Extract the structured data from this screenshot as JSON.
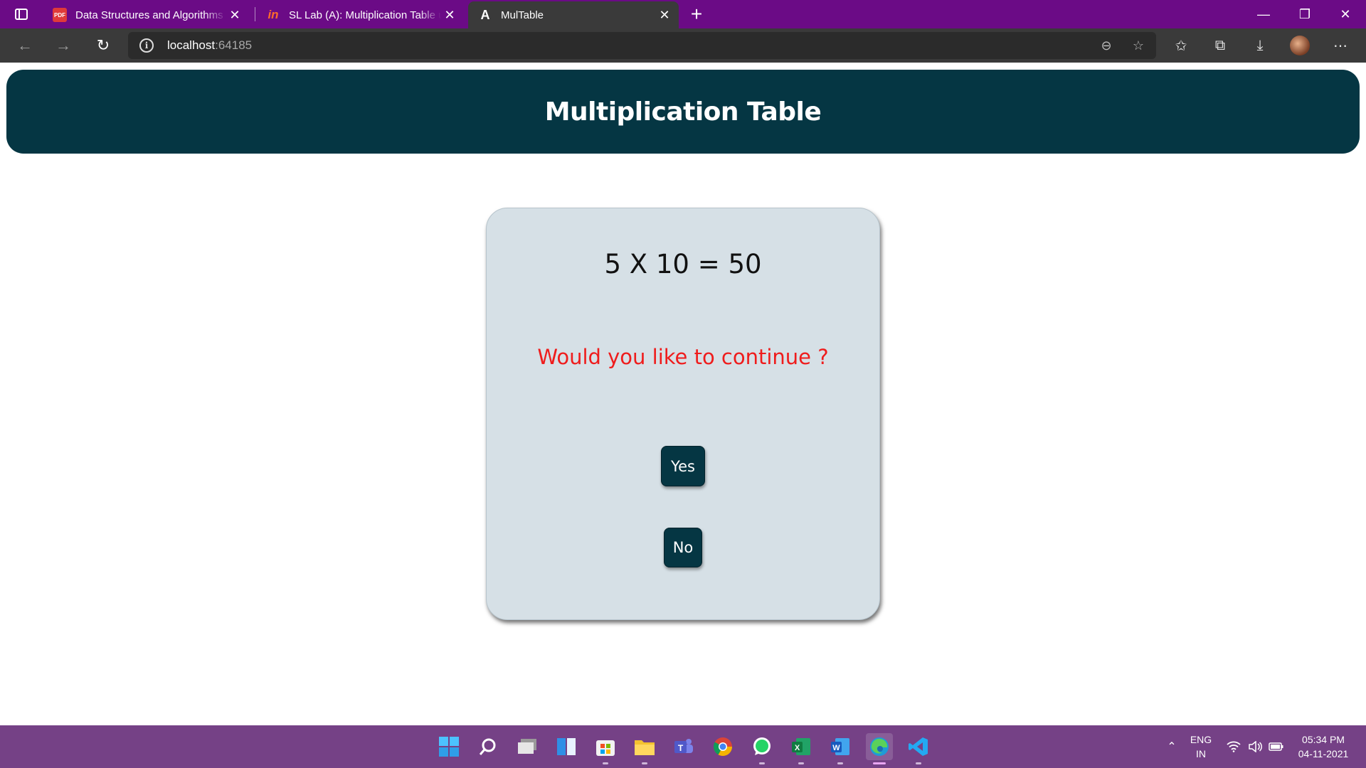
{
  "browser": {
    "tabs": [
      {
        "title": "Data Structures and Algorithms",
        "icon": "pdf-icon",
        "active": false
      },
      {
        "title": "SL Lab (A): Multiplication Table u",
        "icon": "invision-icon",
        "active": false
      },
      {
        "title": "MulTable",
        "icon": "angular-icon",
        "active": true
      }
    ],
    "address": {
      "host": "localhost",
      "port": ":64185"
    },
    "accent_color": "#6b0b86"
  },
  "page": {
    "header_title": "Multiplication Table",
    "equation": "5 X 10 = 50",
    "question": "Would you like to continue ?",
    "yes_label": "Yes",
    "no_label": "No",
    "colors": {
      "header_bg": "#053643",
      "card_bg": "#d6e0e6",
      "question_color": "#ef1c1c"
    }
  },
  "taskbar": {
    "apps": [
      "start-icon",
      "search-icon",
      "task-view-icon",
      "widgets-icon",
      "store-icon",
      "file-explorer-icon",
      "teams-icon",
      "chrome-icon",
      "whatsapp-icon",
      "excel-icon",
      "word-icon",
      "edge-icon",
      "vscode-icon"
    ],
    "lang_top": "ENG",
    "lang_bottom": "IN",
    "time": "05:34 PM",
    "date": "04-11-2021"
  }
}
